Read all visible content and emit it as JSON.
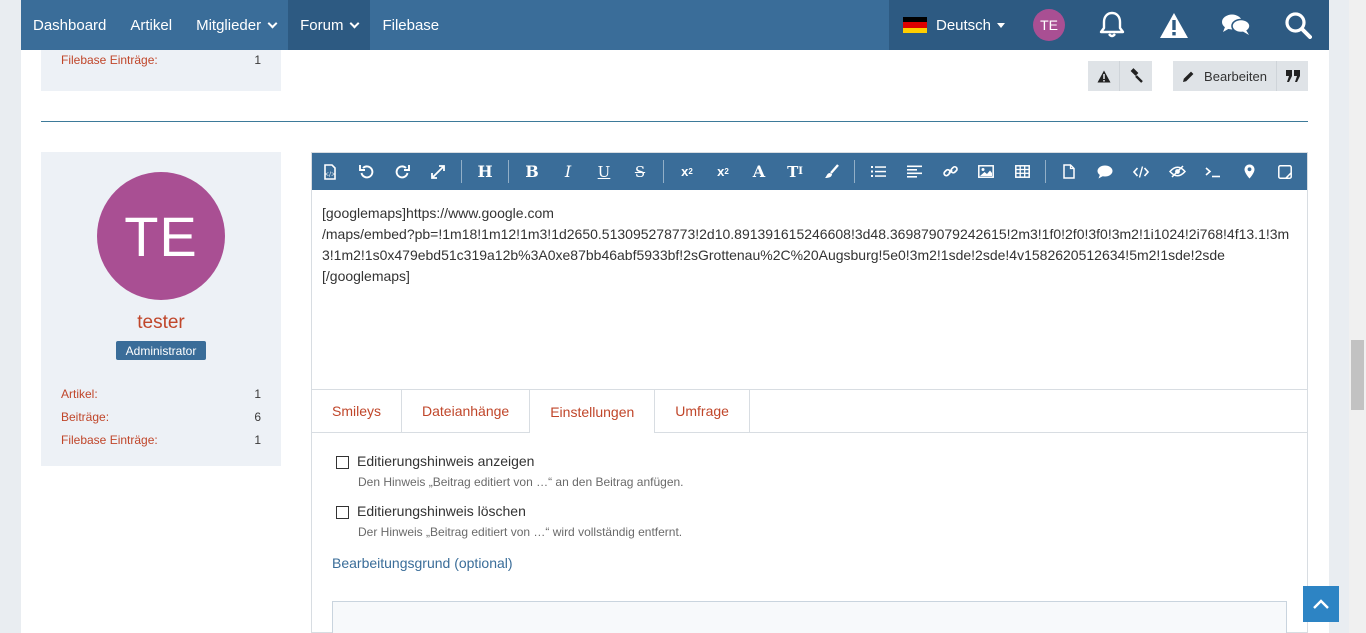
{
  "nav": {
    "items": [
      {
        "label": "Dashboard",
        "dropdown": false,
        "active": false
      },
      {
        "label": "Artikel",
        "dropdown": false,
        "active": false
      },
      {
        "label": "Mitglieder",
        "dropdown": true,
        "active": false
      },
      {
        "label": "Forum",
        "dropdown": true,
        "active": true
      },
      {
        "label": "Filebase",
        "dropdown": false,
        "active": false
      }
    ],
    "language": "Deutsch",
    "avatar_initials": "TE",
    "icons": [
      "bell-icon",
      "warning-icon",
      "comments-icon",
      "search-icon"
    ]
  },
  "previous_post": {
    "stat_label": "Filebase Einträge:",
    "stat_value": "1",
    "edit_label": "Bearbeiten"
  },
  "author": {
    "avatar_initials": "TE",
    "name": "tester",
    "role": "Administrator",
    "stats": [
      {
        "label": "Artikel:",
        "value": "1"
      },
      {
        "label": "Beiträge:",
        "value": "6"
      },
      {
        "label": "Filebase Einträge:",
        "value": "1"
      }
    ]
  },
  "editor": {
    "toolbar_icons": [
      "source-icon",
      "undo-icon",
      "redo-icon",
      "fullscreen-icon",
      "heading-icon",
      "bold-icon",
      "italic-icon",
      "underline-icon",
      "strikethrough-icon",
      "subscript-icon",
      "superscript-icon",
      "font-size-icon",
      "text-color-icon",
      "paint-brush-icon",
      "list-icon",
      "align-icon",
      "link-icon",
      "image-icon",
      "table-icon",
      "document-icon",
      "quote-icon",
      "code-icon",
      "spoiler-icon",
      "inline-code-icon",
      "map-marker-icon",
      "media-icon"
    ],
    "content": "[googlemaps]https://www.google.com\n/maps/embed?pb=!1m18!1m12!1m3!1d2650.513095278773!2d10.891391615246608!3d48.369879079242615!2m3!1f0!2f0!3f0!3m2!1i1024!2i768!4f13.1!3m3!1m2!1s0x479ebd51c319a12b%3A0xe87bb46abf5933bf!2sGrottenau%2C%20Augsburg!5e0!3m2!1sde!2sde!4v1582620512634!5m2!1sde!2sde\n[/googlemaps]",
    "tabs": [
      {
        "label": "Smileys",
        "active": false
      },
      {
        "label": "Dateianhänge",
        "active": false
      },
      {
        "label": "Einstellungen",
        "active": true
      },
      {
        "label": "Umfrage",
        "active": false
      }
    ],
    "options": [
      {
        "label": "Editierungshinweis anzeigen",
        "description": "Den Hinweis „Beitrag editiert von …“ an den Beitrag anfügen.",
        "checked": false
      },
      {
        "label": "Editierungshinweis löschen",
        "description": "Der Hinweis „Beitrag editiert von …“ wird vollständig entfernt.",
        "checked": false
      }
    ],
    "reason_label": "Bearbeitungsgrund (optional)",
    "reason_value": ""
  },
  "colors": {
    "nav_bg": "#3a6d99",
    "nav_dark": "#2d5a82",
    "link": "#c0462a",
    "avatar": "#a94f93",
    "scroll_top": "#2d84c4"
  }
}
